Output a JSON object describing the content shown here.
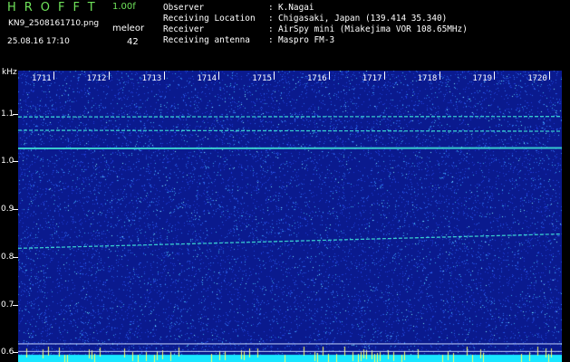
{
  "header": {
    "app_name": "HROFFT",
    "version": "1.00f",
    "filename": "KN9_2508161710.png",
    "mode": "meleor",
    "datetime": "25.08.16 17:10",
    "count": "42"
  },
  "meta": [
    {
      "label": "Observer",
      "value": "K.Nagai"
    },
    {
      "label": "Receiving Location",
      "value": "Chigasaki, Japan (139.414 35.340)"
    },
    {
      "label": "Receiver",
      "value": "AirSpy mini (Miakejima VOR 108.65MHz)"
    },
    {
      "label": "Receiving antenna",
      "value": "Maspro FM-3"
    }
  ],
  "colors": {
    "background": "#0a1a8e",
    "echo": "#40e8d8",
    "bottom_band": "#18e6ff",
    "title_green": "#6fe35a"
  },
  "chart_data": {
    "type": "heatmap",
    "title": "",
    "xlabel": "",
    "ylabel": "kHz",
    "x_ticks": [
      "1711",
      "1712",
      "1713",
      "1714",
      "1715",
      "1716",
      "1717",
      "1718",
      "1719",
      "1720"
    ],
    "y_ticks": [
      "1.1",
      "1.0",
      "0.9",
      "0.8",
      "0.7",
      "0.6"
    ],
    "ylim": [
      0.58,
      1.19
    ],
    "lines": [
      {
        "name": "",
        "freq_start": 1.027,
        "freq_end": 1.028
      },
      {
        "name": "",
        "freq_start": 1.093,
        "freq_end": 1.094
      },
      {
        "name": "",
        "freq_start": 1.065,
        "freq_end": 1.063
      },
      {
        "name": "",
        "freq_start": 0.818,
        "freq_end": 0.848
      },
      {
        "name": "",
        "freq_start": 0.618,
        "freq_end": 0.618
      },
      {
        "name": "",
        "freq_start": 0.602,
        "freq_end": 0.602
      }
    ]
  }
}
